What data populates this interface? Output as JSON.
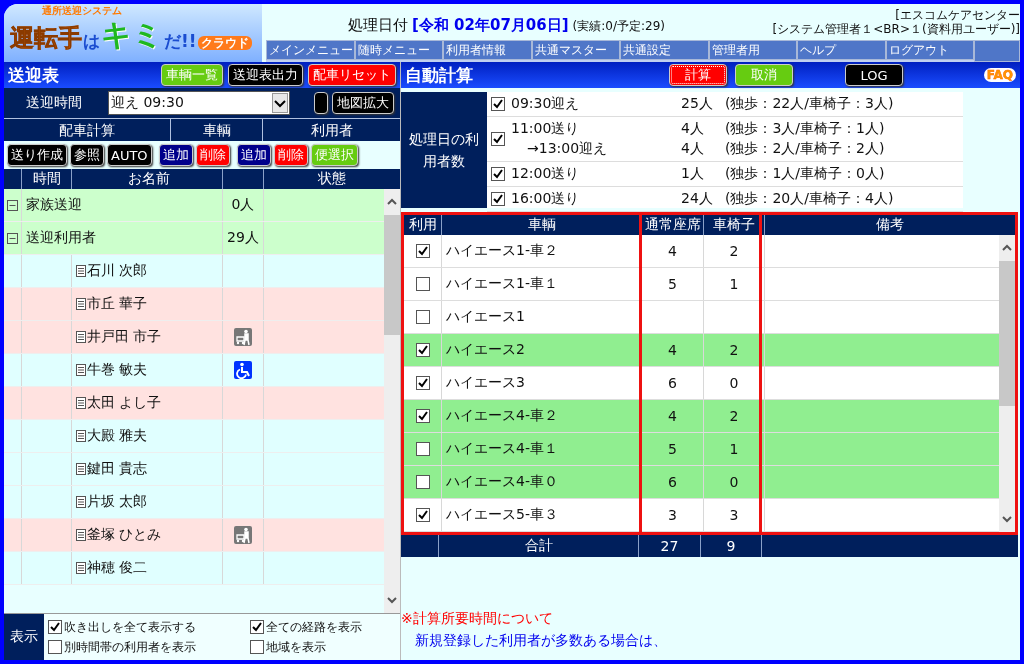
{
  "logo": {
    "tagline": "通所送迎システム",
    "parts": [
      {
        "text": "運転手",
        "kind": "orange"
      },
      {
        "text": "は",
        "kind": "blue"
      },
      {
        "text": "キミ",
        "kind": "green"
      },
      {
        "text": "だ!!",
        "kind": "blue"
      },
      {
        "text": "クラウド",
        "kind": "badge"
      }
    ]
  },
  "header": {
    "date_label": "処理日付",
    "date": "[令和 02年07月06日]",
    "counts": "(実績:0/予定:29)",
    "org": "[エスコムケアセンター",
    "user": "[システム管理者１<BR>１(資料用ユーザー)]"
  },
  "menu": [
    "メインメニュー",
    "随時メニュー",
    "利用者情報",
    "共通マスター",
    "共通設定",
    "管理者用",
    "ヘルプ",
    "ログアウト"
  ],
  "left": {
    "title": "送迎表",
    "buttons": [
      {
        "label": "車輌一覧",
        "kind": "green"
      },
      {
        "label": "送迎表出力",
        "kind": "black"
      },
      {
        "label": "配車リセット",
        "kind": "red"
      }
    ],
    "time_label": "送迎時間",
    "time_value": "迎え 09:30",
    "map_button": "地図拡大",
    "sections": [
      "配車計算",
      "車輌",
      "利用者"
    ],
    "actions": [
      {
        "label": "送り作成",
        "kind": "black"
      },
      {
        "label": "参照",
        "kind": "black"
      },
      {
        "label": "AUTO",
        "kind": "black"
      },
      {
        "label": "追加",
        "kind": "navy"
      },
      {
        "label": "削除",
        "kind": "red"
      },
      {
        "label": "追加",
        "kind": "navy"
      },
      {
        "label": "削除",
        "kind": "red"
      },
      {
        "label": "便選択",
        "kind": "green"
      }
    ],
    "columns": [
      "時間",
      "お名前",
      "状態"
    ],
    "groups": [
      {
        "name": "家族送迎",
        "count": "0人",
        "expanded": true
      },
      {
        "name": "送迎利用者",
        "count": "29人",
        "expanded": true
      }
    ],
    "users": [
      {
        "name": "石川 次郎",
        "color": "#e0ffff"
      },
      {
        "name": "市丘 華子",
        "color": "#ffe2e0"
      },
      {
        "name": "井戸田 市子",
        "color": "#ffe2e0",
        "kind": "walker"
      },
      {
        "name": "牛巻 敏夫",
        "color": "#e0ffff",
        "kind": "wheelchair"
      },
      {
        "name": "太田 よし子",
        "color": "#ffe2e0"
      },
      {
        "name": "大殿 雅夫",
        "color": "#e0ffff"
      },
      {
        "name": "鍵田 貴志",
        "color": "#e0ffff"
      },
      {
        "name": "片坂 太郎",
        "color": "#e0ffff"
      },
      {
        "name": "釜塚 ひとみ",
        "color": "#ffe2e0",
        "kind": "walker"
      },
      {
        "name": "神穂 俊二",
        "color": "#e0ffff"
      }
    ],
    "display_label": "表示",
    "options": [
      {
        "label": "吹き出しを全て表示する",
        "checked": true
      },
      {
        "label": "全ての経路を表示",
        "checked": true
      },
      {
        "label": "別時間帯の利用者を表示",
        "checked": false
      },
      {
        "label": "地域を表示",
        "checked": false
      }
    ]
  },
  "right": {
    "title": "自動計算",
    "buttons": [
      {
        "label": "計算",
        "kind": "red"
      },
      {
        "label": "取消",
        "kind": "green"
      },
      {
        "label": "LOG",
        "kind": "black"
      }
    ],
    "faq": "FAQ",
    "count_label": "処理日の利用者数",
    "counts": [
      {
        "checked": true,
        "lines": [
          {
            "time": "09:30迎え",
            "count": "25人",
            "detail": "(独歩：22人/車椅子：3人)"
          }
        ]
      },
      {
        "checked": true,
        "lines": [
          {
            "time": "11:00送り",
            "count": "4人",
            "detail": "(独歩：3人/車椅子：1人)"
          },
          {
            "time": "→13:00迎え",
            "count": "4人",
            "detail": "(独歩：2人/車椅子：2人)"
          }
        ]
      },
      {
        "checked": true,
        "lines": [
          {
            "time": "12:00送り",
            "count": "1人",
            "detail": "(独歩：1人/車椅子：0人)"
          }
        ]
      },
      {
        "checked": true,
        "lines": [
          {
            "time": "16:00送り",
            "count": "24人",
            "detail": "(独歩：20人/車椅子：4人)"
          }
        ]
      }
    ],
    "columns": [
      "利用",
      "車輌",
      "通常座席",
      "車椅子",
      "備考"
    ],
    "vehicles": [
      {
        "checked": true,
        "highlighted": false,
        "name": "ハイエース1-車２",
        "seats": "4",
        "wheelchairs": "2"
      },
      {
        "checked": false,
        "highlighted": false,
        "name": "ハイエース1-車１",
        "seats": "5",
        "wheelchairs": "1"
      },
      {
        "checked": false,
        "highlighted": false,
        "name": "ハイエース1"
      },
      {
        "checked": true,
        "highlighted": true,
        "name": "ハイエース2",
        "seats": "4",
        "wheelchairs": "2"
      },
      {
        "checked": true,
        "highlighted": false,
        "name": "ハイエース3",
        "seats": "6",
        "wheelchairs": "0"
      },
      {
        "checked": true,
        "highlighted": true,
        "name": "ハイエース4-車２",
        "seats": "4",
        "wheelchairs": "2"
      },
      {
        "checked": false,
        "highlighted": true,
        "name": "ハイエース4-車１",
        "seats": "5",
        "wheelchairs": "1"
      },
      {
        "checked": false,
        "highlighted": true,
        "name": "ハイエース4-車０",
        "seats": "6",
        "wheelchairs": "0"
      },
      {
        "checked": true,
        "highlighted": false,
        "name": "ハイエース5-車３",
        "seats": "3",
        "wheelchairs": "3"
      }
    ],
    "total": {
      "label": "合計",
      "seats": "27",
      "wheelchairs": "9"
    },
    "note_title": "※計算所要時間について",
    "note_text": "新規登録した利用者が多数ある場合は、"
  }
}
